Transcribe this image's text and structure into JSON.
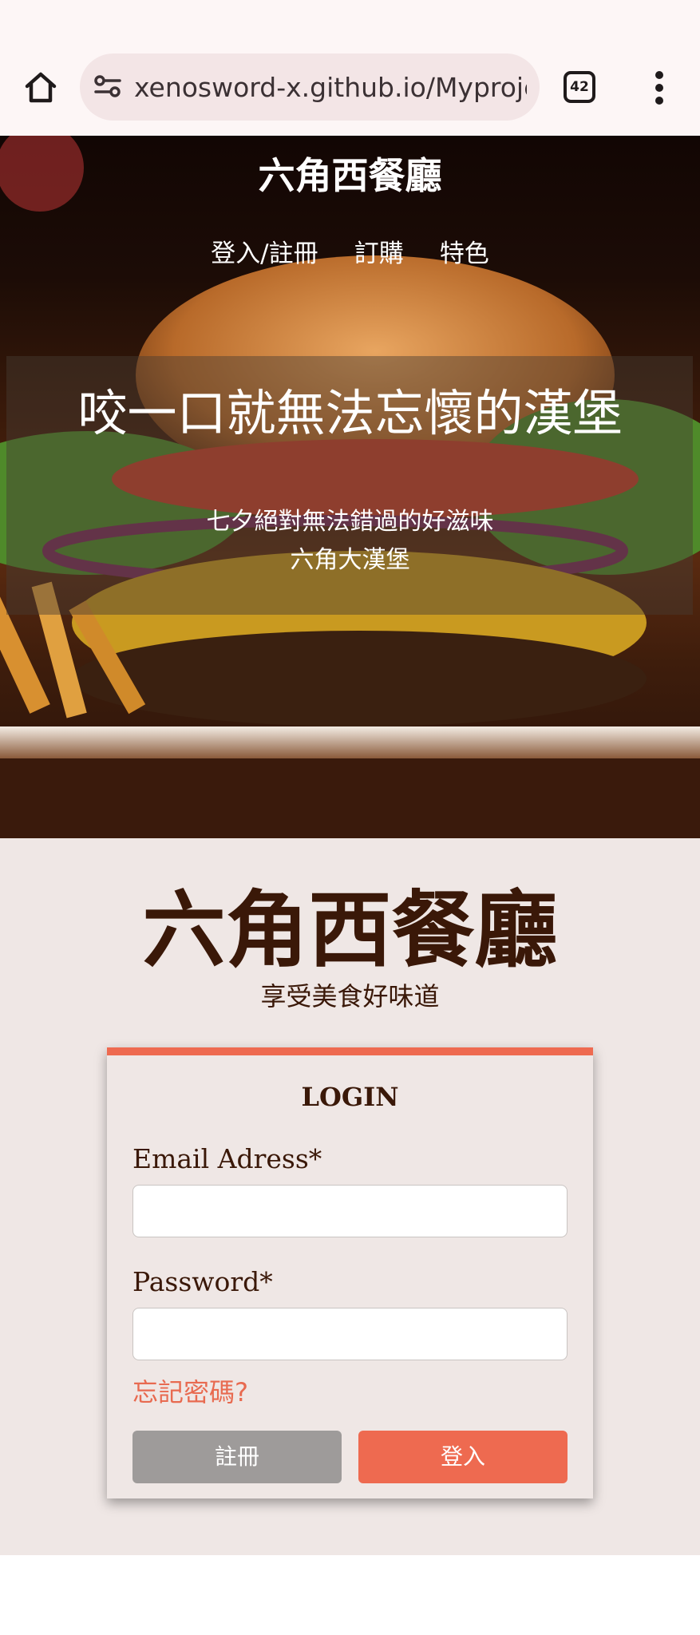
{
  "browser": {
    "url": "xenosword-x.github.io/Myprojec",
    "tab_count": "42",
    "home_icon": "home-icon",
    "site_info_icon": "tune-icon",
    "menu_icon": "more-vert-icon"
  },
  "hero": {
    "site_title": "六角西餐廳",
    "nav": [
      {
        "label": "登入/註冊"
      },
      {
        "label": "訂購"
      },
      {
        "label": "特色"
      }
    ],
    "headline": "咬一口就無法忘懷的漢堡",
    "sub_line1": "七夕絕對無法錯過的好滋味",
    "sub_line2": "六角大漢堡"
  },
  "brand": {
    "name": "六角西餐廳",
    "tagline": "享受美食好味道"
  },
  "login": {
    "title": "LOGIN",
    "email_label": "Email Adress*",
    "email_value": "",
    "password_label": "Password*",
    "password_value": "",
    "forgot_label": "忘記密碼?",
    "register_label": "註冊",
    "login_label": "登入"
  },
  "colors": {
    "accent": "#ee6a50",
    "brand_text": "#3a1808",
    "section_bg": "#efe7e5",
    "register_button": "#9e9b9a"
  }
}
